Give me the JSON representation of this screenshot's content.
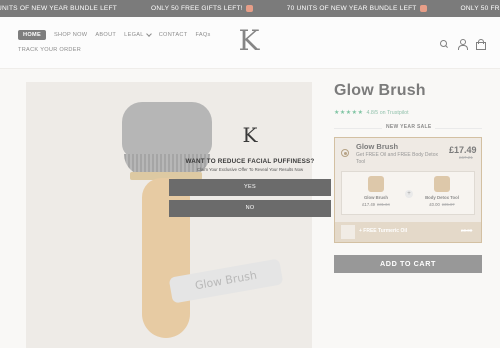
{
  "announcement": {
    "messages": [
      "UNITS OF NEW YEAR BUNDLE LEFT",
      "ONLY 50 FREE GIFTS LEFT!",
      "70 UNITS OF NEW YEAR BUNDLE LEFT",
      "ONLY 50 FREE GIFTS LEFT!"
    ],
    "gift_icons": [
      "gift-icon",
      "gift-icon"
    ]
  },
  "header": {
    "nav": [
      "HOME",
      "SHOP NOW",
      "ABOUT",
      "LEGAL",
      "CONTACT",
      "FAQs"
    ],
    "nav_second_row": "TRACK YOUR ORDER",
    "logo_letter": "K",
    "icons": [
      "search-icon",
      "user-icon",
      "cart-icon"
    ]
  },
  "product": {
    "title": "Glow Brush",
    "rating_text": "4.8/5 on Trustpilot",
    "stars": [
      "★",
      "★",
      "★",
      "★",
      "★"
    ],
    "strap_text": "Glow Brush"
  },
  "popup": {
    "logo_letter": "K",
    "question": "WANT TO REDUCE FACIAL PUFFINESS?",
    "subtitle": "Claim Your Exclusive Offer To Reveal Your Results Now",
    "yes_label": "YES",
    "no_label": "NO"
  },
  "offer": {
    "section_label": "NEW YEAR SALE",
    "title": "Glow Brush",
    "description": "Get FREE Oil and FREE Body Detox Tool",
    "price": "£17.49",
    "compare_price": "£67.21",
    "bundle": [
      {
        "name": "Glow Brush",
        "price": "£17.49",
        "was": "£31.34"
      },
      {
        "name": "Body Detox Tool",
        "price": "£0.00",
        "was": "£35.87"
      }
    ],
    "plus_symbol": "+",
    "gift_text": "+ FREE Turmeric Oil",
    "gift_value": "£0.00"
  },
  "cart": {
    "label": "ADD TO CART"
  },
  "colors": {
    "accent": "#2fa06a",
    "offer_border": "#b99a6a",
    "cart_button": "#5a5a5a"
  }
}
